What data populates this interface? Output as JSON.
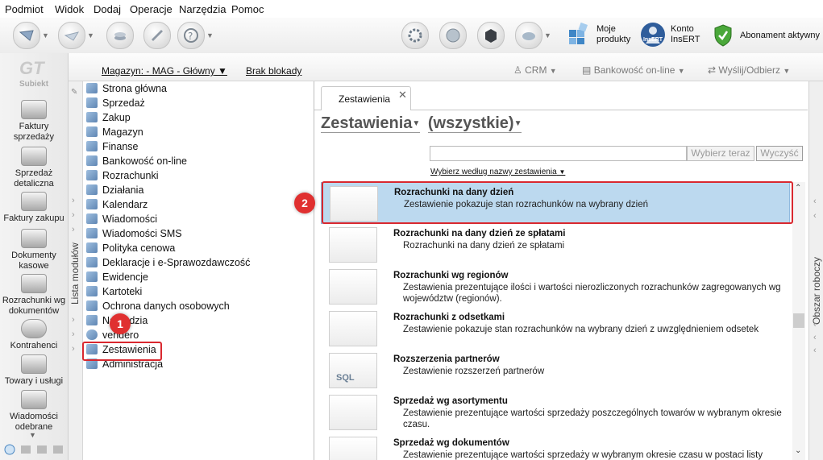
{
  "menu": [
    "Podmiot",
    "Widok",
    "Dodaj",
    "Operacje",
    "Narzędzia",
    "Pomoc"
  ],
  "toolbar_right": {
    "moje_produkty": [
      "Moje",
      "produkty"
    ],
    "konto": [
      "Konto",
      "InsERT"
    ],
    "konto_logo": "InsERT",
    "abonament": "Abonament aktywny"
  },
  "app_logo": "Subiekt",
  "leftbar": [
    {
      "label": "Faktury sprzedaży",
      "icon": "invoice-icon"
    },
    {
      "label": "Sprzedaż detaliczna",
      "icon": "retail-icon"
    },
    {
      "label": "Faktury zakupu",
      "icon": "purchase-icon"
    },
    {
      "label": "Dokumenty kasowe",
      "icon": "cash-icon"
    },
    {
      "label": "Rozrachunki wg dokumentów",
      "icon": "settlements-icon"
    },
    {
      "label": "Kontrahenci",
      "icon": "contractors-icon"
    },
    {
      "label": "Towary i usługi",
      "icon": "goods-icon"
    },
    {
      "label": "Wiadomości odebrane",
      "icon": "messages-icon"
    }
  ],
  "subheader": {
    "magazyn": "Magazyn: - MAG - Główny",
    "blokady": "Brak blokady",
    "crm": "CRM",
    "bankowosc": "Bankowość on-line",
    "wyslij": "Wyślij/Odbierz"
  },
  "modules_label": "Lista modułów",
  "modules": [
    "Strona główna",
    "Sprzedaż",
    "Zakup",
    "Magazyn",
    "Finanse",
    "Bankowość on-line",
    "Rozrachunki",
    "Działania",
    "Kalendarz",
    "Wiadomości",
    "Wiadomości SMS",
    "Polityka cenowa",
    "Deklaracje i e-Sprawozdawczość",
    "Ewidencje",
    "Kartoteki",
    "Ochrona danych osobowych",
    "Narzędzia",
    "vendero",
    "Zestawienia",
    "Administracja"
  ],
  "tab": "Zestawienia",
  "heading": {
    "left": "Zestawienia",
    "right": "(wszystkie)"
  },
  "search": {
    "value": "",
    "btn_choose": "Wybierz teraz",
    "btn_clear": "Wyczyść",
    "sort_link": "Wybierz według nazwy zestawienia"
  },
  "work_area_label": "Obszar roboczy",
  "reports": [
    {
      "title": "Rozrachunki na dany dzień",
      "desc": "Zestawienie pokazuje stan rozrachunków na wybrany dzień",
      "selected": true
    },
    {
      "title": "Rozrachunki na dany dzień ze spłatami",
      "desc": "Rozrachunki na dany dzień ze spłatami"
    },
    {
      "title": "Rozrachunki wg regionów",
      "desc": "Zestawienia prezentujące ilości i wartości nierozliczonych rozrachunków zagregowanych wg województw (regionów)."
    },
    {
      "title": "Rozrachunki z odsetkami",
      "desc": "Zestawienie pokazuje stan rozrachunków na wybrany dzień z uwzględnieniem odsetek"
    },
    {
      "title": "Rozszerzenia partnerów",
      "desc": "Zestawienie rozszerzeń partnerów",
      "thumb_text": "SQL"
    },
    {
      "title": "Sprzedaż wg asortymentu",
      "desc": "Zestawienie prezentujące wartości sprzedaży poszczególnych towarów w wybranym okresie czasu."
    },
    {
      "title": "Sprzedaż wg dokumentów",
      "desc": "Zestawienie prezentujące wartości sprzedaży w wybranym okresie czasu w postaci listy"
    }
  ],
  "annotations": {
    "one": "1",
    "two": "2"
  },
  "colors": {
    "selected_bg": "#bcd9ef",
    "annotation_red": "#d9282f",
    "accent_blue": "#2f6fb1"
  }
}
